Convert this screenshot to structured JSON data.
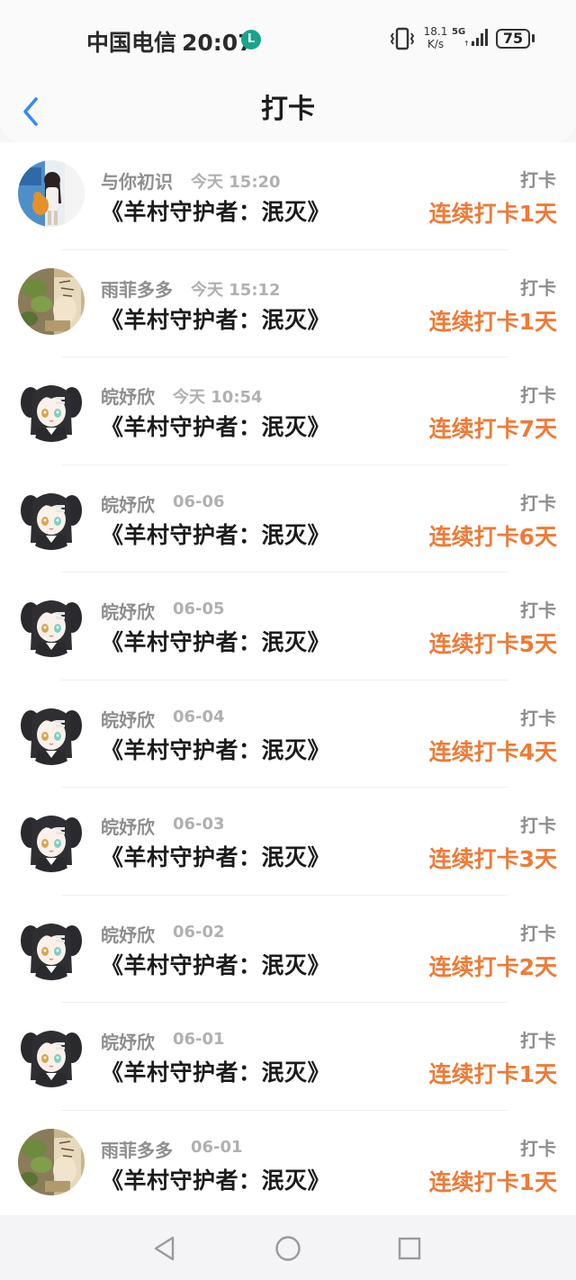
{
  "status": {
    "carrier": "中国电信",
    "time": "20:07",
    "app_badge": "L",
    "speed_value": "18.1",
    "speed_unit": "K/s",
    "network": "5G",
    "battery": "75"
  },
  "header": {
    "title": "打卡",
    "back_icon": "chevron-left-icon"
  },
  "records": [
    {
      "user": "与你初识",
      "time": "今天 15:20",
      "work": "《羊村守护者：泯灭》",
      "tag": "打卡",
      "streak": "连续打卡1天",
      "avatar": "photo-girl"
    },
    {
      "user": "雨菲多多",
      "time": "今天 15:12",
      "work": "《羊村守护者：泯灭》",
      "tag": "打卡",
      "streak": "连续打卡1天",
      "avatar": "photo-art"
    },
    {
      "user": "皖妤欣",
      "time": "今天 10:54",
      "work": "《羊村守护者：泯灭》",
      "tag": "打卡",
      "streak": "连续打卡7天",
      "avatar": "anime-girl"
    },
    {
      "user": "皖妤欣",
      "time": "06-06",
      "work": "《羊村守护者：泯灭》",
      "tag": "打卡",
      "streak": "连续打卡6天",
      "avatar": "anime-girl"
    },
    {
      "user": "皖妤欣",
      "time": "06-05",
      "work": "《羊村守护者：泯灭》",
      "tag": "打卡",
      "streak": "连续打卡5天",
      "avatar": "anime-girl"
    },
    {
      "user": "皖妤欣",
      "time": "06-04",
      "work": "《羊村守护者：泯灭》",
      "tag": "打卡",
      "streak": "连续打卡4天",
      "avatar": "anime-girl"
    },
    {
      "user": "皖妤欣",
      "time": "06-03",
      "work": "《羊村守护者：泯灭》",
      "tag": "打卡",
      "streak": "连续打卡3天",
      "avatar": "anime-girl"
    },
    {
      "user": "皖妤欣",
      "time": "06-02",
      "work": "《羊村守护者：泯灭》",
      "tag": "打卡",
      "streak": "连续打卡2天",
      "avatar": "anime-girl"
    },
    {
      "user": "皖妤欣",
      "time": "06-01",
      "work": "《羊村守护者：泯灭》",
      "tag": "打卡",
      "streak": "连续打卡1天",
      "avatar": "anime-girl"
    },
    {
      "user": "雨菲多多",
      "time": "06-01",
      "work": "《羊村守护者：泯灭》",
      "tag": "打卡",
      "streak": "连续打卡1天",
      "avatar": "photo-art"
    }
  ],
  "navbar": {
    "back": "triangle-back-icon",
    "home": "circle-home-icon",
    "recents": "square-recents-icon"
  },
  "colors": {
    "accent_streak": "#f07a35",
    "back_chevron": "#2e8ff0",
    "muted_text": "#8e8e8e"
  }
}
